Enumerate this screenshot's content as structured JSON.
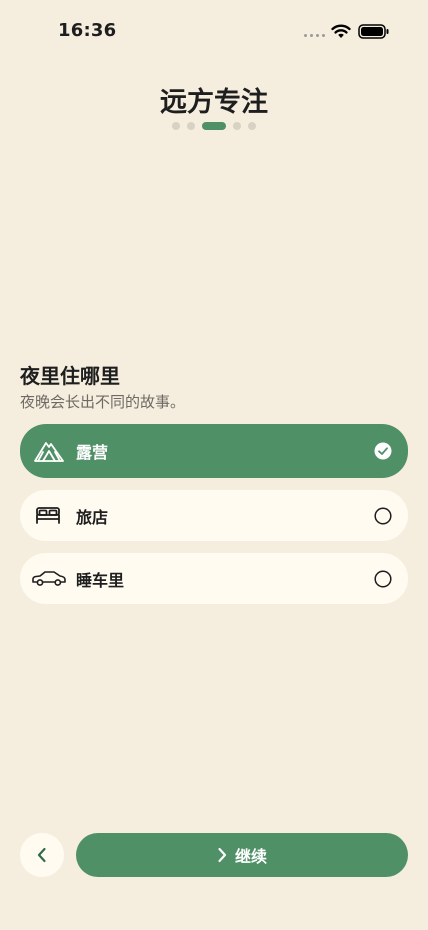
{
  "status_bar": {
    "time": "16:36",
    "wifi_icon": "wifi-icon",
    "battery_icon": "battery-icon"
  },
  "header": {
    "title": "远方专注",
    "pager": {
      "total": 5,
      "active_index": 2
    }
  },
  "section": {
    "title": "夜里住哪里",
    "subtitle": "夜晚会长出不同的故事。"
  },
  "options": [
    {
      "label": "露营",
      "icon": "tent-icon",
      "selected": true
    },
    {
      "label": "旅店",
      "icon": "bed-icon",
      "selected": false
    },
    {
      "label": "睡车里",
      "icon": "car-icon",
      "selected": false
    }
  ],
  "footer": {
    "back_icon": "chevron-left-icon",
    "continue_label": "继续",
    "continue_icon": "chevron-right-icon"
  },
  "colors": {
    "background": "#F5EEDF",
    "accent": "#4F9066",
    "card": "#FFFBF1",
    "text": "#1E1E1E",
    "muted": "#6E6A63"
  }
}
